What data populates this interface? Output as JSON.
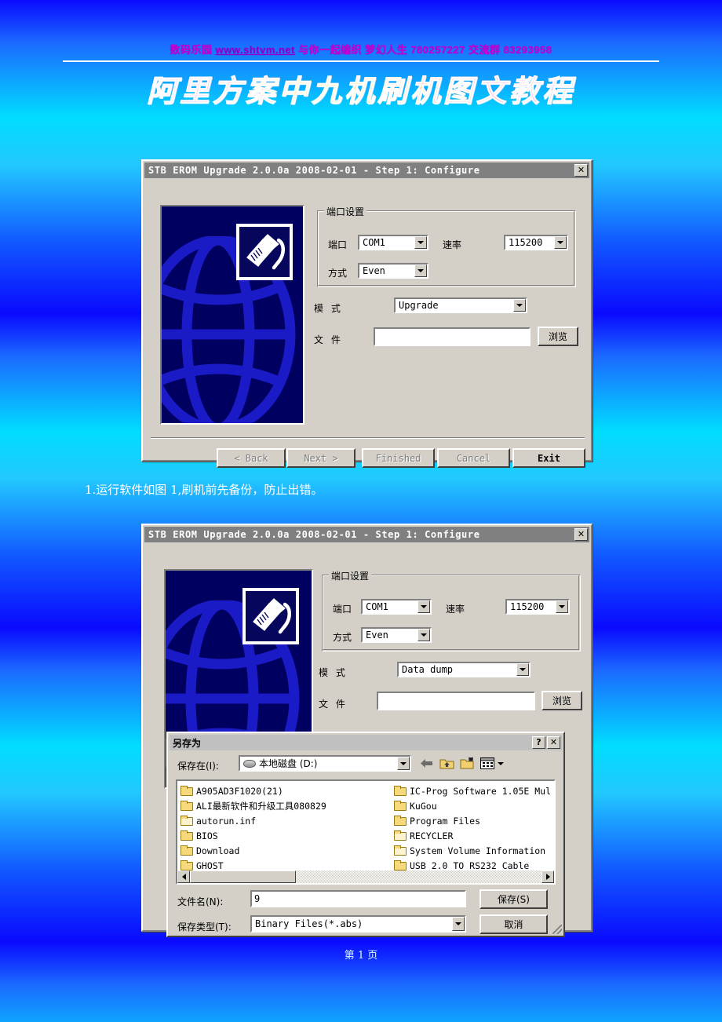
{
  "header": {
    "promo_prefix": "数码乐园 ",
    "promo_url": "www.shtvm.net",
    "promo_mid": " 与你一起编织  梦幻人生    780257227    交流群 83293958",
    "title": "阿里方案中九机刷机图文教程"
  },
  "footer": {
    "page_label": "第 1 页"
  },
  "caption1": "1.运行软件如图 1,刷机前先备份，防止出错。",
  "dialog1": {
    "title": "STB EROM Upgrade 2.0.0a 2008-02-01 - Step 1: Configure",
    "close_label": "✕",
    "group_port": "端口设置",
    "label_port": "端口",
    "value_port": "COM1",
    "label_speed": "速率",
    "value_speed": "115200",
    "label_parity": "方式",
    "value_parity": "Even",
    "label_mode": "模 式",
    "value_mode": "Upgrade",
    "label_file": "文 件",
    "value_file": "",
    "browse_label": "浏览",
    "buttons": [
      {
        "label": "< Back",
        "disabled": true
      },
      {
        "label": "Next >",
        "disabled": true
      },
      {
        "label": "Finished",
        "disabled": true
      },
      {
        "label": "Cancel",
        "disabled": true
      },
      {
        "label": "Exit",
        "disabled": false
      }
    ]
  },
  "dialog2": {
    "title": "STB EROM Upgrade 2.0.0a 2008-02-01 - Step 1: Configure",
    "close_label": "✕",
    "group_port": "端口设置",
    "label_port": "端口",
    "value_port": "COM1",
    "label_speed": "速率",
    "value_speed": "115200",
    "label_parity": "方式",
    "value_parity": "Even",
    "label_mode": "模 式",
    "value_mode": "Data dump",
    "label_file": "文 件",
    "value_file": "",
    "browse_label": "浏览"
  },
  "saveas": {
    "title": "另存为",
    "help_label": "?",
    "close_label": "✕",
    "label_savein": "保存在(I):",
    "value_savein": "本地磁盘 (D:)",
    "toolbar": [
      {
        "icon": "back-arrow-icon"
      },
      {
        "icon": "up-folder-icon"
      },
      {
        "icon": "new-folder-icon"
      },
      {
        "icon": "views-icon"
      }
    ],
    "files_left": [
      {
        "name": "A905AD3F1020(21)",
        "type": "folder"
      },
      {
        "name": "ALI最新软件和升级工具080829",
        "type": "folder"
      },
      {
        "name": "autorun.inf",
        "type": "folder-pale"
      },
      {
        "name": "BIOS",
        "type": "folder"
      },
      {
        "name": "Download",
        "type": "folder"
      },
      {
        "name": "GHOST",
        "type": "folder"
      }
    ],
    "files_right": [
      {
        "name": "IC-Prog Software 1.05E Mul",
        "type": "folder"
      },
      {
        "name": "KuGou",
        "type": "folder"
      },
      {
        "name": "Program Files",
        "type": "folder"
      },
      {
        "name": "RECYCLER",
        "type": "folder-pale"
      },
      {
        "name": "System Volume Information",
        "type": "folder-pale"
      },
      {
        "name": "USB 2.0 TO RS232 Cable",
        "type": "folder"
      }
    ],
    "label_filename": "文件名(N):",
    "value_filename": "9",
    "label_filetype": "保存类型(T):",
    "value_filetype": "Binary Files(*.abs)",
    "save_label": "保存(S)",
    "cancel_label": "取消"
  },
  "colors": {
    "dialog_face": "#d4d0c8",
    "titlebar_inactive": "#808080",
    "panel_navy": "#000060",
    "globe_blue": "#1818c8",
    "banner_promo": "#c000d0"
  }
}
